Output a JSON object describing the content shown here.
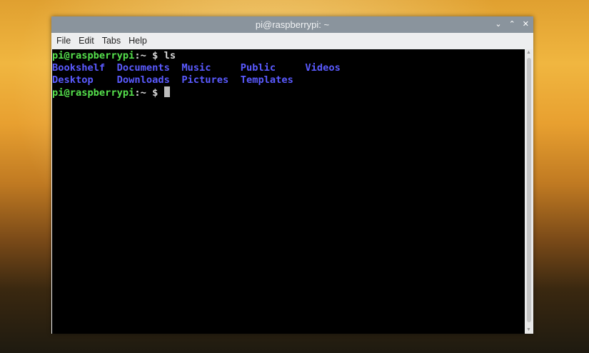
{
  "window": {
    "title": "pi@raspberrypi: ~"
  },
  "menu": [
    "File",
    "Edit",
    "Tabs",
    "Help"
  ],
  "terminal": {
    "prompt_user": "pi@raspberrypi",
    "prompt_path": ":~ $ ",
    "command": "ls",
    "row1": [
      "Bookshelf  ",
      "Documents  ",
      "Music     ",
      "Public     ",
      "Videos"
    ],
    "row2": [
      "Desktop    ",
      "Downloads  ",
      "Pictures  ",
      "Templates"
    ]
  },
  "colors": {
    "prompt": "#55e04c",
    "directory": "#5a5aff"
  }
}
